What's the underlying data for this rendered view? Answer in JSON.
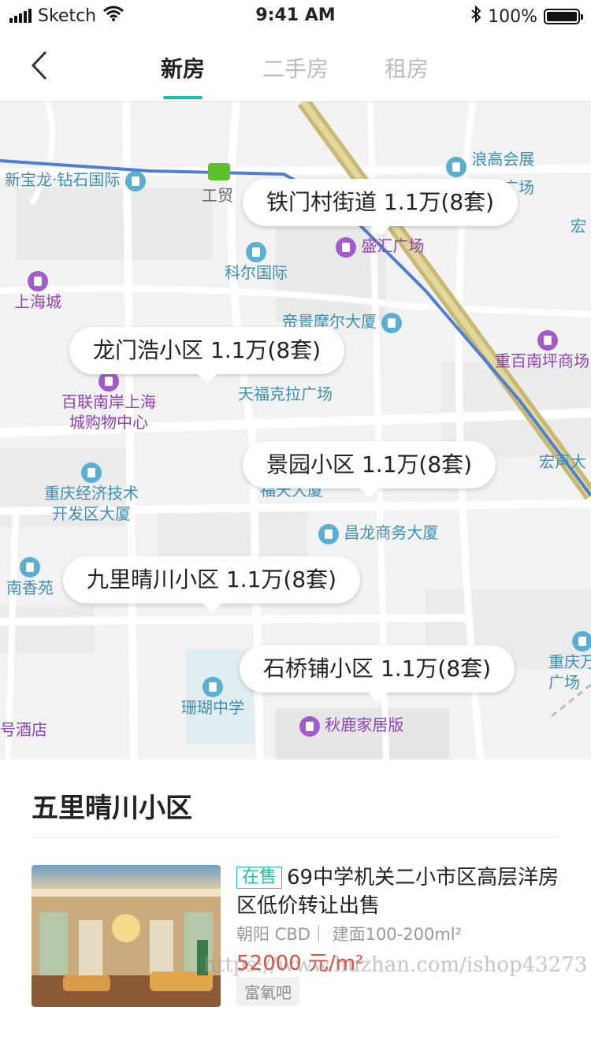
{
  "status_bar": {
    "carrier": "Sketch",
    "time": "9:41 AM",
    "battery": "100%"
  },
  "nav": {
    "back_icon": "chevron-left-icon",
    "tabs": [
      {
        "label": "新房",
        "active": true
      },
      {
        "label": "二手房",
        "active": false
      },
      {
        "label": "租房",
        "active": false
      }
    ],
    "accent_color": "#1fbfa5"
  },
  "map": {
    "pois": [
      {
        "label": "新宝龙·钻石国际"
      },
      {
        "label": "工贸"
      },
      {
        "label": "浪高会展"
      },
      {
        "label": "国际广场"
      },
      {
        "label": "宏"
      },
      {
        "label": "盛汇广场"
      },
      {
        "label": "科尔国际"
      },
      {
        "label": "上海城"
      },
      {
        "label": "帝景摩尔大厦"
      },
      {
        "label": "重百南坪商场"
      },
      {
        "label": "百联南岸上海"
      },
      {
        "label": "城购物中心"
      },
      {
        "label": "天福克拉广场"
      },
      {
        "label": "宏声大"
      },
      {
        "label": "重庆经济技术"
      },
      {
        "label": "开发区大厦"
      },
      {
        "label": "福天大厦"
      },
      {
        "label": "昌龙商务大厦"
      },
      {
        "label": "南香苑"
      },
      {
        "label": "重庆万"
      },
      {
        "label": "广场"
      },
      {
        "label": "珊瑚中学"
      },
      {
        "label": "秋鹿家居版"
      },
      {
        "label": "号酒店"
      }
    ],
    "bubbles": [
      {
        "label": "铁门村街道 1.1万(8套)"
      },
      {
        "label": "龙门浩小区 1.1万(8套)"
      },
      {
        "label": "景园小区 1.1万(8套)"
      },
      {
        "label": "九里晴川小区 1.1万(8套)"
      },
      {
        "label": "石桥铺小区 1.1万(8套)"
      }
    ]
  },
  "sheet": {
    "title": "五里晴川小区",
    "listing": {
      "tag": "在售",
      "title": "69中学机关二小市区高层洋房区低价转让出售",
      "meta": "朝阳 CBD｜ 建面100-200ml²",
      "price": "52000 元/m²",
      "chip": "富氧吧"
    }
  },
  "watermark": "https://www.huzhan.com/ishop43273"
}
